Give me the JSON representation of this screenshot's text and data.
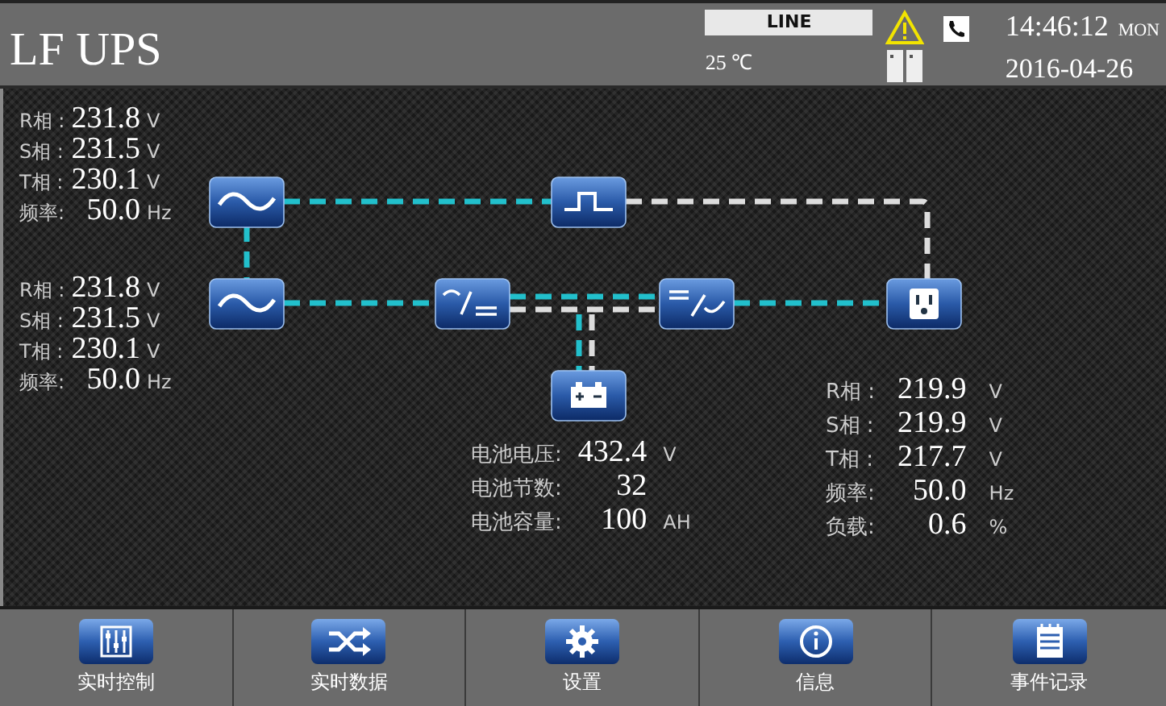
{
  "header": {
    "title": "LF UPS",
    "mode": "LINE",
    "temperature": "25 ℃",
    "time": "14:46:12",
    "weekday": "MON",
    "date": "2016-04-26"
  },
  "input_main": [
    {
      "label": "R相 :",
      "value": "231.8",
      "unit": "V"
    },
    {
      "label": "S相 :",
      "value": "231.5",
      "unit": "V"
    },
    {
      "label": "T相 :",
      "value": "230.1",
      "unit": "V"
    },
    {
      "label": "频率:",
      "value": "50.0",
      "unit": "Hz"
    }
  ],
  "input_bypass": [
    {
      "label": "R相 :",
      "value": "231.8",
      "unit": "V"
    },
    {
      "label": "S相 :",
      "value": "231.5",
      "unit": "V"
    },
    {
      "label": "T相 :",
      "value": "230.1",
      "unit": "V"
    },
    {
      "label": "频率:",
      "value": "50.0",
      "unit": "Hz"
    }
  ],
  "battery": [
    {
      "label": "电池电压:",
      "value": "432.4",
      "unit": "V"
    },
    {
      "label": "电池节数:",
      "value": "32"
    },
    {
      "label": "电池容量:",
      "value": "100",
      "unit": "AH"
    }
  ],
  "output": [
    {
      "label": "R相 :",
      "value": "219.9",
      "unit": "V"
    },
    {
      "label": "S相 :",
      "value": "219.9",
      "unit": "V"
    },
    {
      "label": "T相 :",
      "value": "217.7",
      "unit": "V"
    },
    {
      "label": "频率:",
      "value": "50.0",
      "unit": "Hz"
    },
    {
      "label": "负载:",
      "value": "0.6",
      "unit": "%"
    }
  ],
  "nav": [
    {
      "label": "实时控制"
    },
    {
      "label": "实时数据"
    },
    {
      "label": "设置"
    },
    {
      "label": "信息"
    },
    {
      "label": "事件记录"
    }
  ]
}
